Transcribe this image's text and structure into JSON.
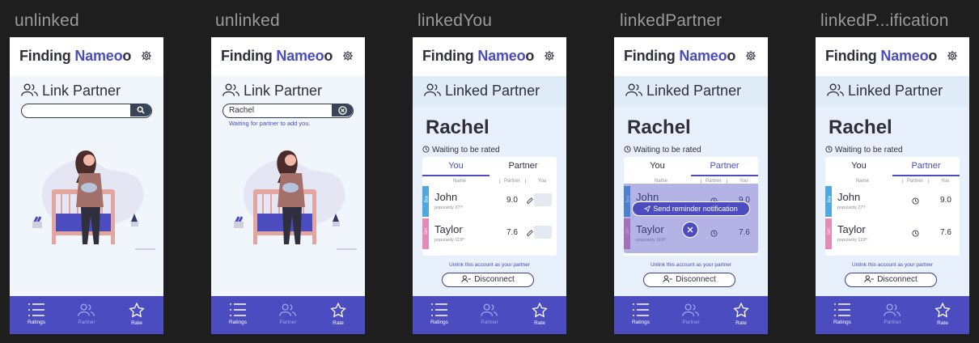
{
  "app": {
    "title_part1": "Finding ",
    "title_accent": "Nameo",
    "title_part2": "o"
  },
  "colors": {
    "accent": "#4a4cc0",
    "boy": "#4fa8de",
    "girl": "#e589b6",
    "dark": "#2f2f3e"
  },
  "frames": [
    {
      "label": "unlinked",
      "section_title": "Link Partner",
      "search_value": "",
      "search_icon": "search-icon"
    },
    {
      "label": "unlinked",
      "section_title": "Link Partner",
      "search_value": "Rachel",
      "search_icon": "clear-icon",
      "hint": "Waiting for partner to add you."
    },
    {
      "label": "linkedYou",
      "section_title": "Linked Partner",
      "partner_name": "Rachel",
      "status": "Waiting to be rated"
    },
    {
      "label": "linkedPartner",
      "section_title": "Linked Partner",
      "partner_name": "Rachel",
      "status": "Waiting to be rated",
      "overlay_button": "Send reminder notification"
    },
    {
      "label": "linkedP...ification",
      "section_title": "Linked Partner",
      "partner_name": "Rachel",
      "status": "Waiting to be rated"
    }
  ],
  "table": {
    "tab_you": "You",
    "tab_partner": "Partner",
    "col_name": "Name",
    "col_partner": "Partner",
    "col_you": "You",
    "rows": [
      {
        "sex": "Boy",
        "name": "John",
        "popularity": "popularity 27ᵗʰ",
        "partner_score": "9.0"
      },
      {
        "sex": "Girl",
        "name": "Taylor",
        "popularity": "popularity 119ᵗʰ",
        "partner_score": "7.6"
      }
    ]
  },
  "unlink_text": "Unlink this account as your partner",
  "disconnect_label": "Disconnect",
  "nav": {
    "ratings": "Ratings",
    "partner": "Partner",
    "rate": "Rate"
  }
}
